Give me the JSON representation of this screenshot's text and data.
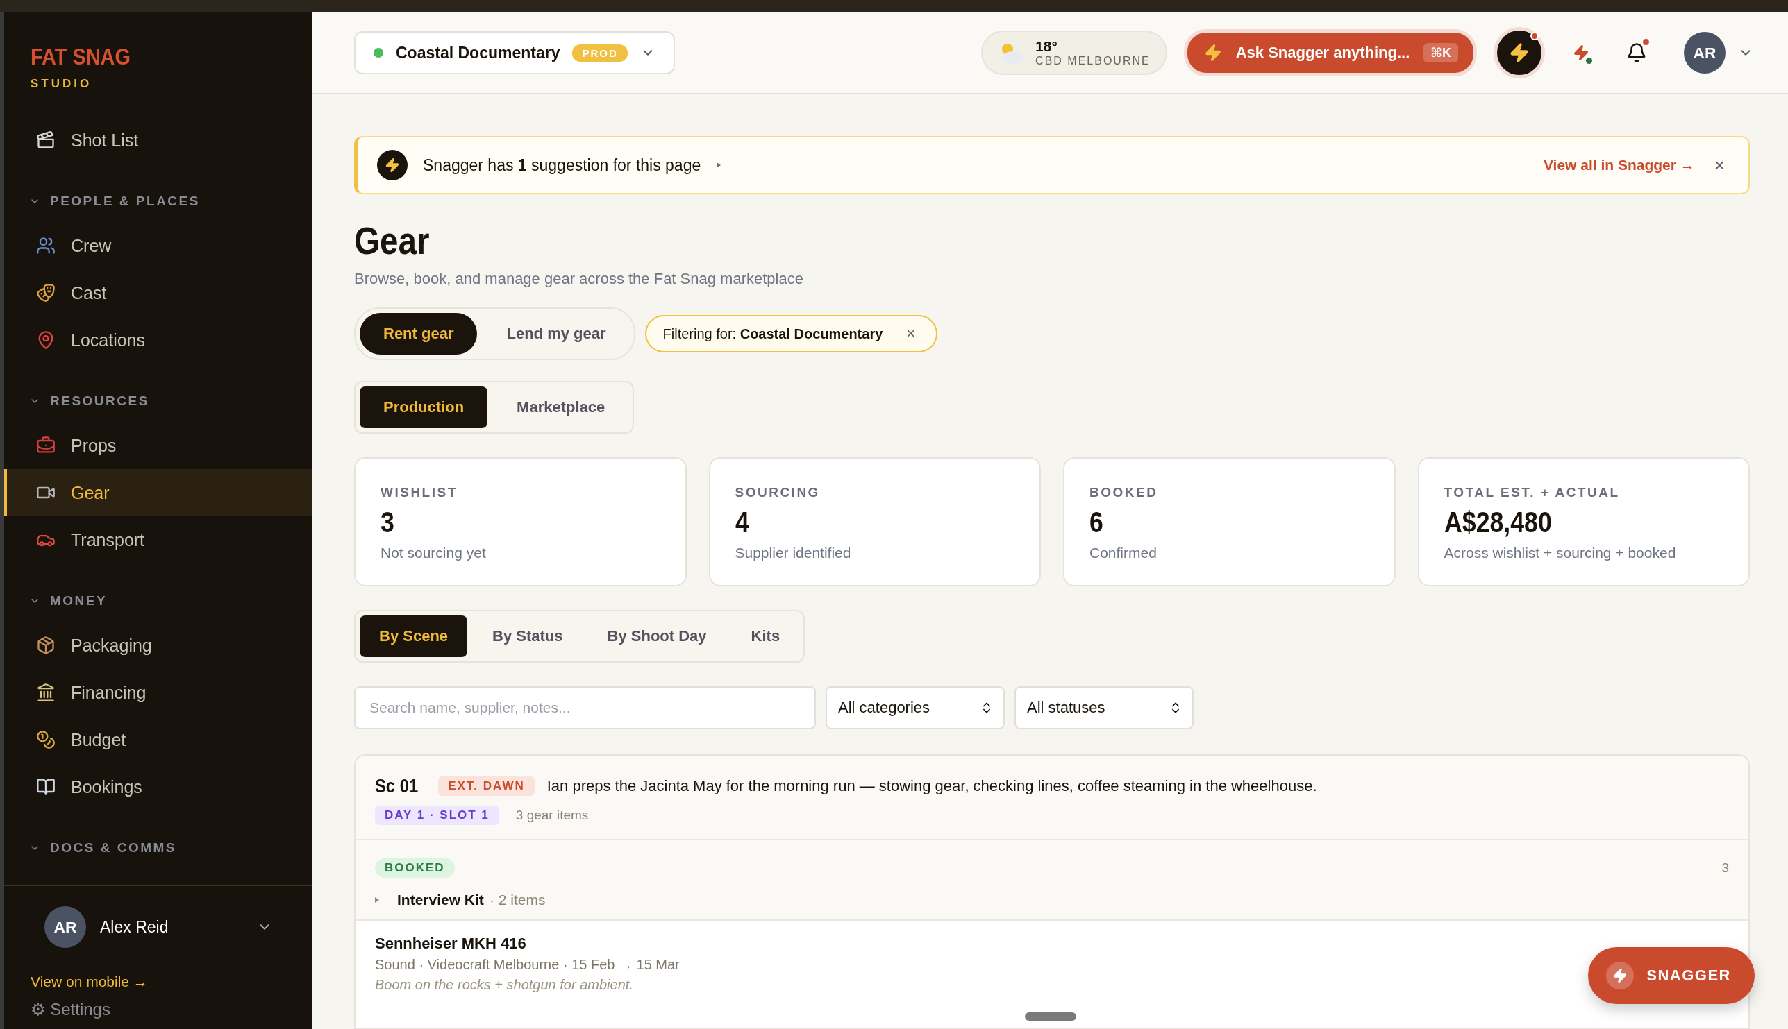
{
  "sidebar": {
    "brand": {
      "name": "FAT SNAG",
      "tagline": "STUDIO"
    },
    "nav": [
      {
        "kind": "item",
        "label": "Shot List",
        "selected": false
      },
      {
        "kind": "section",
        "label": "PEOPLE & PLACES",
        "expanded": true
      },
      {
        "kind": "item",
        "label": "Crew",
        "selected": false
      },
      {
        "kind": "item",
        "label": "Cast",
        "selected": false
      },
      {
        "kind": "item",
        "label": "Locations",
        "selected": false
      },
      {
        "kind": "section",
        "label": "RESOURCES",
        "expanded": true
      },
      {
        "kind": "item",
        "label": "Props",
        "selected": false
      },
      {
        "kind": "item",
        "label": "Gear",
        "selected": true
      },
      {
        "kind": "item",
        "label": "Transport",
        "selected": false
      },
      {
        "kind": "section",
        "label": "MONEY",
        "expanded": true
      },
      {
        "kind": "item",
        "label": "Packaging",
        "selected": false
      },
      {
        "kind": "item",
        "label": "Financing",
        "selected": false
      },
      {
        "kind": "item",
        "label": "Budget",
        "selected": false
      },
      {
        "kind": "item",
        "label": "Bookings",
        "selected": false
      },
      {
        "kind": "section",
        "label": "DOCS & COMMS",
        "expanded": true
      }
    ],
    "user": {
      "initials": "AR",
      "name": "Alex Reid"
    },
    "mobile_link": "View on mobile →",
    "settings": "⚙ Settings"
  },
  "topbar": {
    "project": {
      "name": "Coastal Documentary",
      "badge": "PROD"
    },
    "weather": {
      "temp": "18°",
      "place": "CBD MELBOURNE"
    },
    "ask": {
      "label": "Ask Snagger anything...",
      "shortcut": "⌘K"
    },
    "snagger_alert": true,
    "notifications_unread": true,
    "avatar": "AR"
  },
  "banner": {
    "text": "Snagger has **1** suggestion for this page",
    "link": "View all in Snagger →",
    "close": "×"
  },
  "page": {
    "title": "Gear",
    "subtitle": "Browse, book, and manage gear across the Fat Snag marketplace",
    "mode_tabs": [
      {
        "label": "Rent gear",
        "selected": true
      },
      {
        "label": "Lend my gear",
        "selected": false
      }
    ],
    "filter": {
      "label": "Filtering for: **Coastal Documentary**",
      "close": "×"
    },
    "source_tabs": [
      {
        "label": "Production",
        "selected": true
      },
      {
        "label": "Marketplace",
        "selected": false
      }
    ],
    "stats": [
      {
        "label": "WISHLIST",
        "value": "3",
        "note": "Not sourcing yet"
      },
      {
        "label": "SOURCING",
        "value": "4",
        "note": "Supplier identified"
      },
      {
        "label": "BOOKED",
        "value": "6",
        "note": "Confirmed"
      },
      {
        "label": "TOTAL EST. + ACTUAL",
        "value": "A$28,480",
        "note": "Across wishlist + sourcing + booked"
      }
    ],
    "view_tabs": [
      {
        "label": "By Scene",
        "selected": true
      },
      {
        "label": "By Status",
        "selected": false
      },
      {
        "label": "By Shoot Day",
        "selected": false
      },
      {
        "label": "Kits",
        "selected": false
      }
    ],
    "search": {
      "placeholder": "Search name, supplier, notes..."
    },
    "selects": [
      {
        "value": "All categories"
      },
      {
        "value": "All statuses"
      }
    ],
    "scene": {
      "number": "Sc 01",
      "tag": "EXT. DAWN",
      "description": "Ian preps the Jacinta May for the morning run — stowing gear, checking lines, coffee steaming in the wheelhouse.",
      "slot": "DAY 1 · SLOT 1",
      "count": "3 gear items",
      "group": {
        "status": "BOOKED",
        "count": "3",
        "kit": {
          "name": "Interview Kit",
          "count": "· 2 items"
        },
        "items": [
          {
            "name": "Sennheiser MKH 416",
            "meta": "Sound · Videocraft Melbourne · 15 Feb → 15 Mar",
            "note": "Boom on the rocks + shotgun for ambient."
          }
        ]
      }
    }
  },
  "fab": {
    "label": "SNAGGER"
  }
}
